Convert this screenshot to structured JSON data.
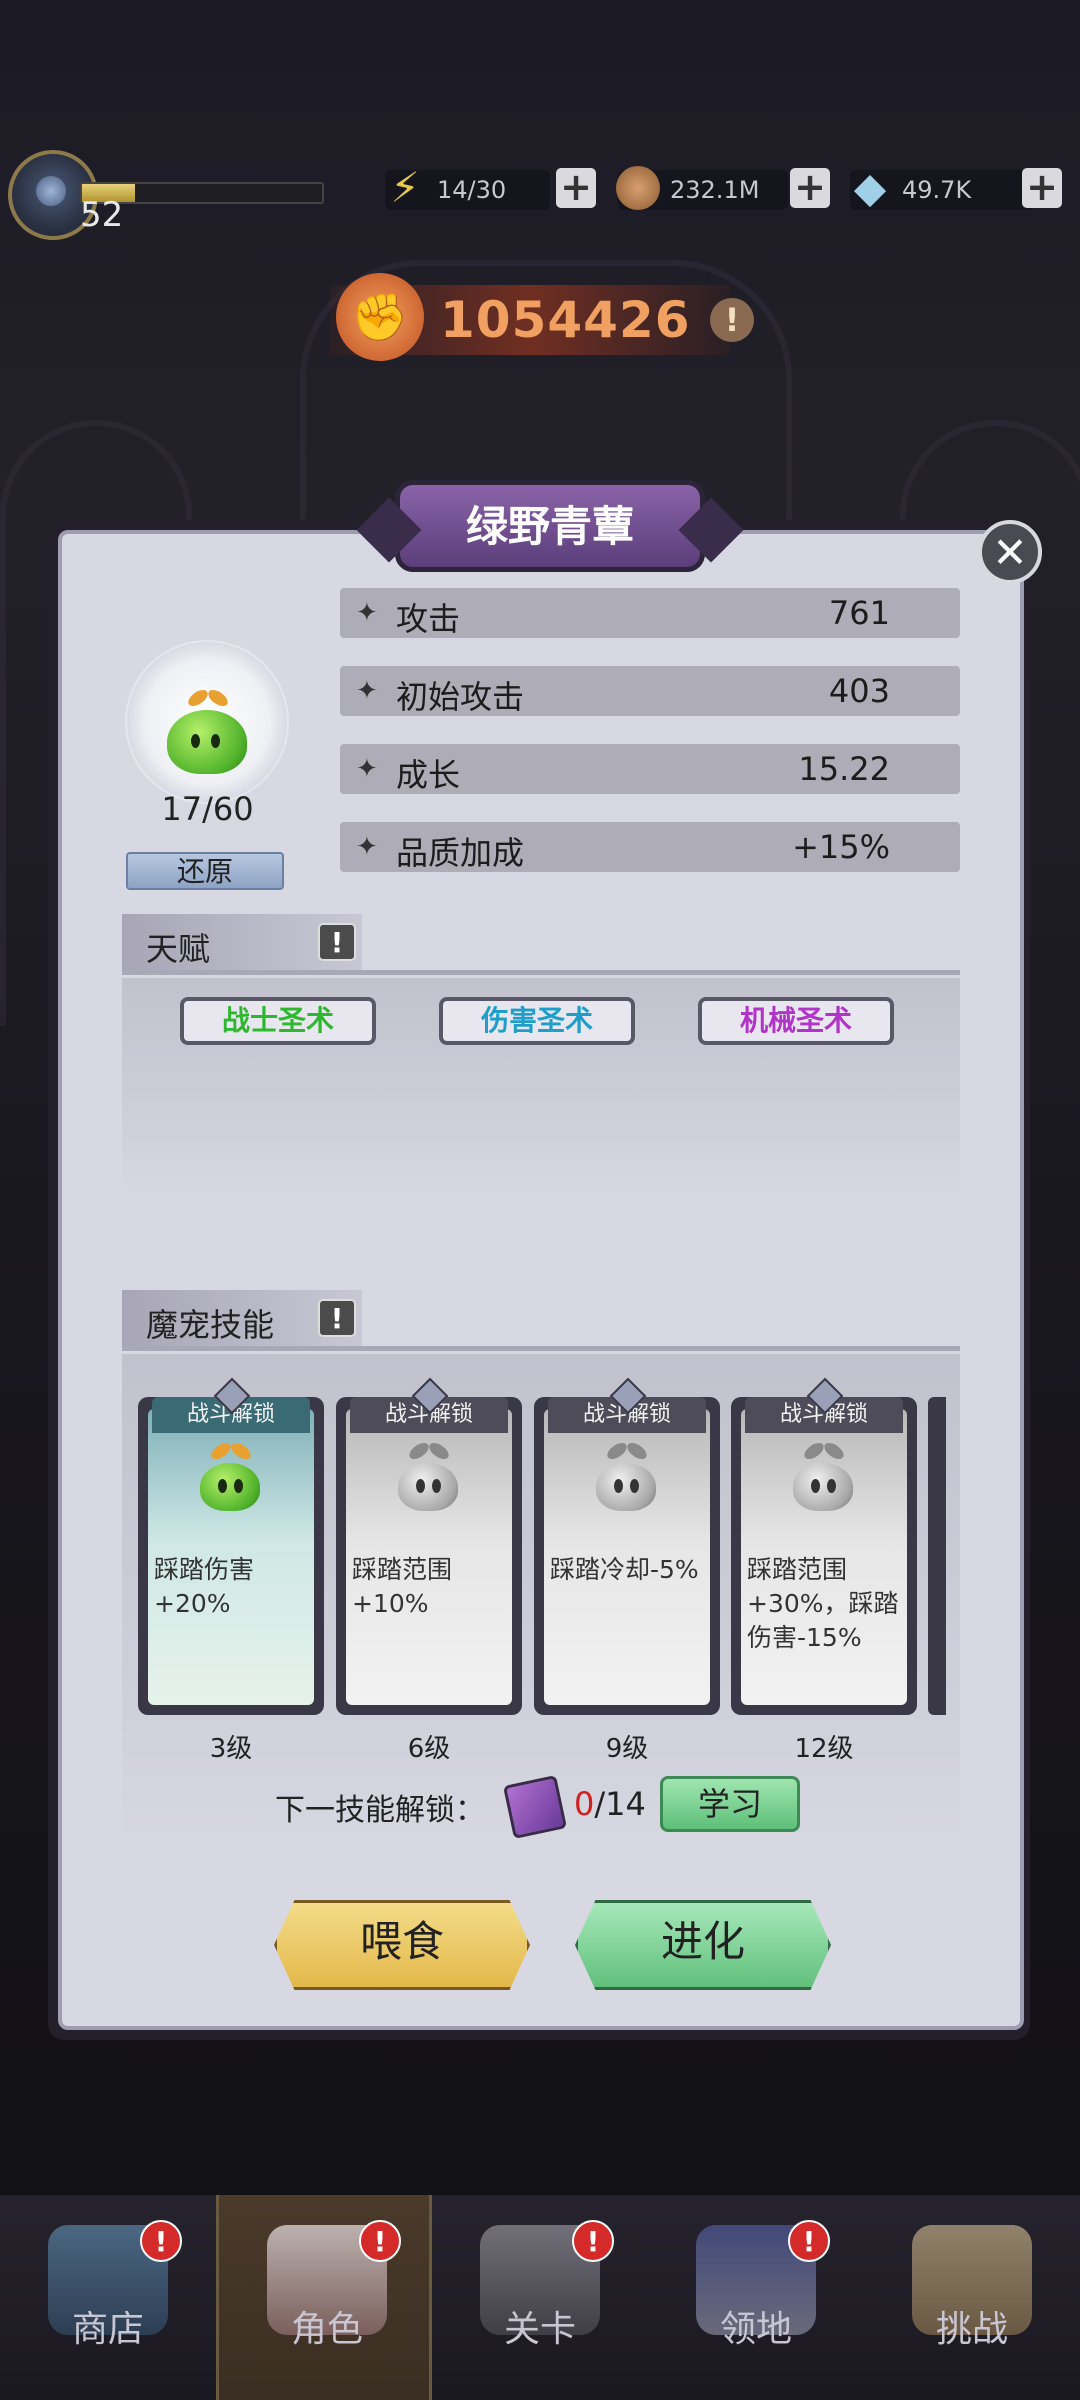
{
  "top_bar": {
    "player_level": "52",
    "energy": "14/30",
    "gold": "232.1M",
    "diamonds": "49.7K",
    "plus_label": "+"
  },
  "power": {
    "value": "1054426",
    "info_icon": "!"
  },
  "pet": {
    "name": "绿野青蕈",
    "level": "17/60",
    "restore_label": "还原"
  },
  "stats": [
    {
      "label": "攻击",
      "value": "761"
    },
    {
      "label": "初始攻击",
      "value": "403"
    },
    {
      "label": "成长",
      "value": "15.22"
    },
    {
      "label": "品质加成",
      "value": "+15%"
    }
  ],
  "talent": {
    "title": "天赋",
    "items": [
      {
        "label": "战士圣术",
        "color": "#2fb82f"
      },
      {
        "label": "伤害圣术",
        "color": "#1e9ec8"
      },
      {
        "label": "机械圣术",
        "color": "#b034c8"
      }
    ]
  },
  "skills": {
    "title": "魔宠技能",
    "cards": [
      {
        "ribbon": "战斗解锁",
        "desc": "踩踏伤害+20%",
        "level": "3级",
        "active": true
      },
      {
        "ribbon": "战斗解锁",
        "desc": "踩踏范围+10%",
        "level": "6级",
        "active": false
      },
      {
        "ribbon": "战斗解锁",
        "desc": "踩踏冷却-5%",
        "level": "9级",
        "active": false
      },
      {
        "ribbon": "战斗解锁",
        "desc": "踩踏范围+30%，踩踏伤害-15%",
        "level": "12级",
        "active": false
      }
    ],
    "next_unlock_label": "下一技能解锁：",
    "book_have": "0",
    "book_need": "/14",
    "learn_label": "学习"
  },
  "actions": {
    "feed": "喂食",
    "evolve": "进化"
  },
  "nav": [
    {
      "label": "商店",
      "badge": "!"
    },
    {
      "label": "角色",
      "badge": "!",
      "active": true
    },
    {
      "label": "关卡",
      "badge": "!"
    },
    {
      "label": "领地",
      "badge": "!"
    },
    {
      "label": "挑战",
      "badge": ""
    }
  ],
  "colors": {
    "accent_purple": "#6b4a8e",
    "badge_red": "#d42a2a"
  }
}
